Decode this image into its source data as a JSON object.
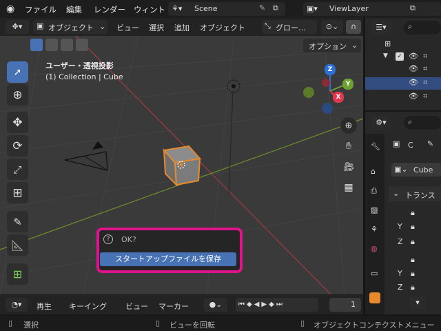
{
  "topbar": {
    "menus": [
      "ファイル",
      "編集",
      "レンダー",
      "ウィント"
    ],
    "scene": "Scene",
    "view_layer": "ViewLayer"
  },
  "viewport_header": {
    "mode": "オブジェクト",
    "menus": [
      "ビュー",
      "選択",
      "追加",
      "オブジェクト"
    ],
    "transform_orientation": "グロー…",
    "options": "オプション"
  },
  "viewport": {
    "view_name": "ユーザー・透視投影",
    "collection_info": "(1) Collection | Cube",
    "gizmo_axes": [
      "Z",
      "Y",
      "X"
    ]
  },
  "dialog": {
    "title": "OK?",
    "button": "スタートアップファイルを保存"
  },
  "timeline": {
    "menus": [
      "再生",
      "キーイング",
      "ビュー",
      "マーカー"
    ],
    "current_frame": "1"
  },
  "statusbar": {
    "left": "選択",
    "middle": "ビューを回転",
    "right": "オブジェクトコンテクストメニュー"
  },
  "properties": {
    "object_letter": "C",
    "object_name": "Cube",
    "section": "トランス",
    "axes": [
      "Y",
      "Z",
      "Y",
      "Z"
    ]
  },
  "colors": {
    "accent": "#4772b3",
    "highlight_frame": "#e0148a",
    "selection_orange": "#e8892c",
    "axis_x": "#e0384e",
    "axis_y": "#6ea032",
    "axis_z": "#2f6fd8"
  }
}
